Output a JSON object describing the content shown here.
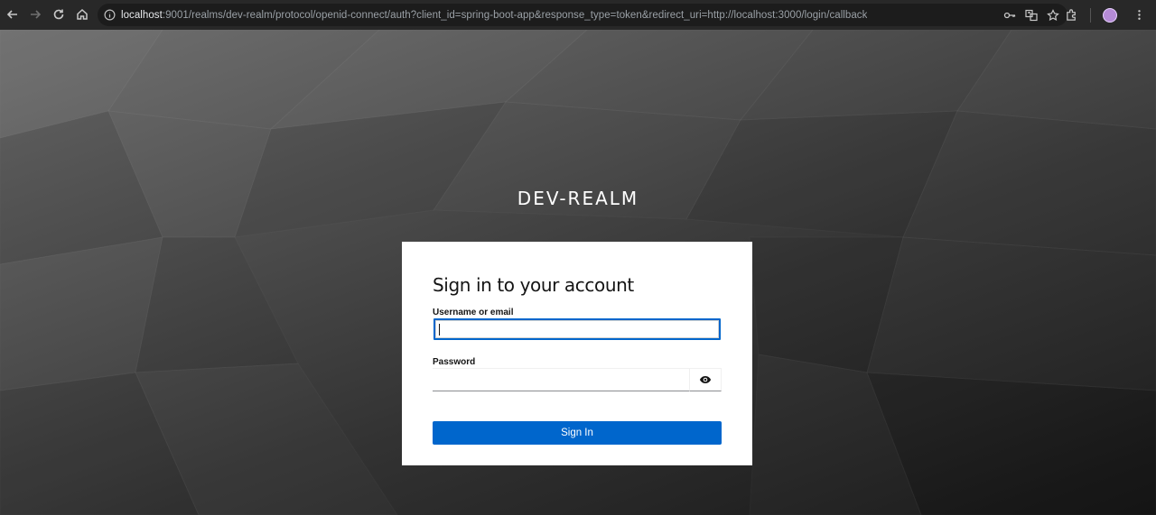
{
  "browser": {
    "url_host": "localhost",
    "url_rest": ":9001/realms/dev-realm/protocol/openid-connect/auth?client_id=spring-boot-app&response_type=token&redirect_uri=http://localhost:3000/login/callback",
    "icons": [
      "back-icon",
      "forward-icon",
      "reload-icon",
      "home-icon",
      "site-info-icon",
      "password-key-icon",
      "translate-icon",
      "bookmark-star-icon",
      "extensions-icon",
      "profile-avatar",
      "menu-kebab-icon"
    ]
  },
  "page": {
    "realm_title": "DEV-REALM",
    "card_title": "Sign in to your account",
    "username_label": "Username or email",
    "username_value": "",
    "password_label": "Password",
    "password_value": "",
    "signin_label": "Sign In"
  },
  "colors": {
    "primary": "#0066cc",
    "toolbar": "#282828",
    "card": "#ffffff"
  }
}
